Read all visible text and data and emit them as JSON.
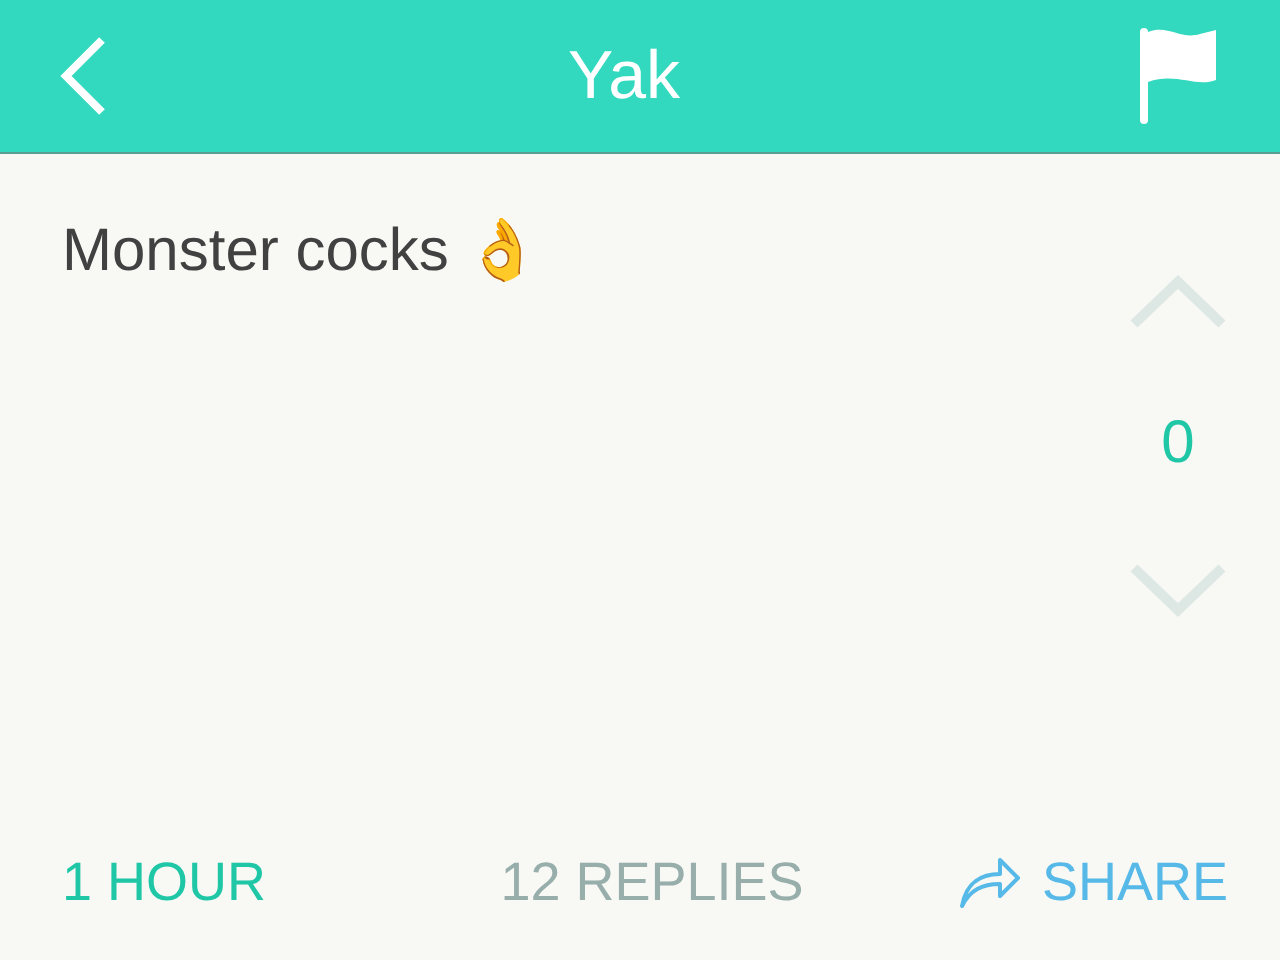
{
  "header": {
    "title": "Yak"
  },
  "post": {
    "text": "Monster cocks 👌",
    "score": "0"
  },
  "footer": {
    "time": "1 HOUR",
    "replies": "12 REPLIES",
    "share": "SHARE"
  }
}
